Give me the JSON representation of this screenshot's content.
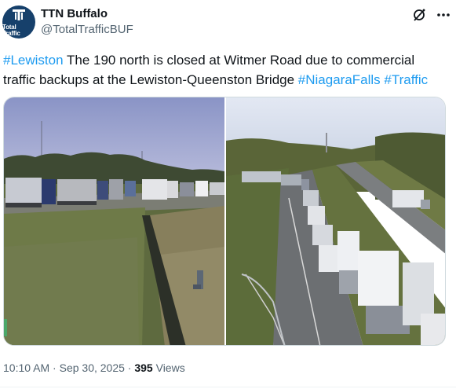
{
  "account": {
    "display_name": "TTN Buffalo",
    "handle": "@TotalTrafficBUF",
    "avatar_text": "Total Traffic"
  },
  "tweet": {
    "hashtag_1": "#Lewiston",
    "text_main": " The 190 north is closed at Witmer Road due to commercial traffic backups at the Lewiston-Queenston Bridge ",
    "hashtag_2": "#NiagaraFalls",
    "hashtag_3": "#Traffic"
  },
  "meta": {
    "time": "10:10 AM",
    "separator_1": " · ",
    "date": "Sep 30, 2025",
    "separator_2": " · ",
    "views_count": "395",
    "views_label": " Views"
  },
  "colors": {
    "link": "#1d9bf0",
    "secondary_text": "#536471",
    "avatar_bg": "#16406b"
  },
  "icons": {
    "grok": "grok-icon",
    "more": "more-icon"
  }
}
